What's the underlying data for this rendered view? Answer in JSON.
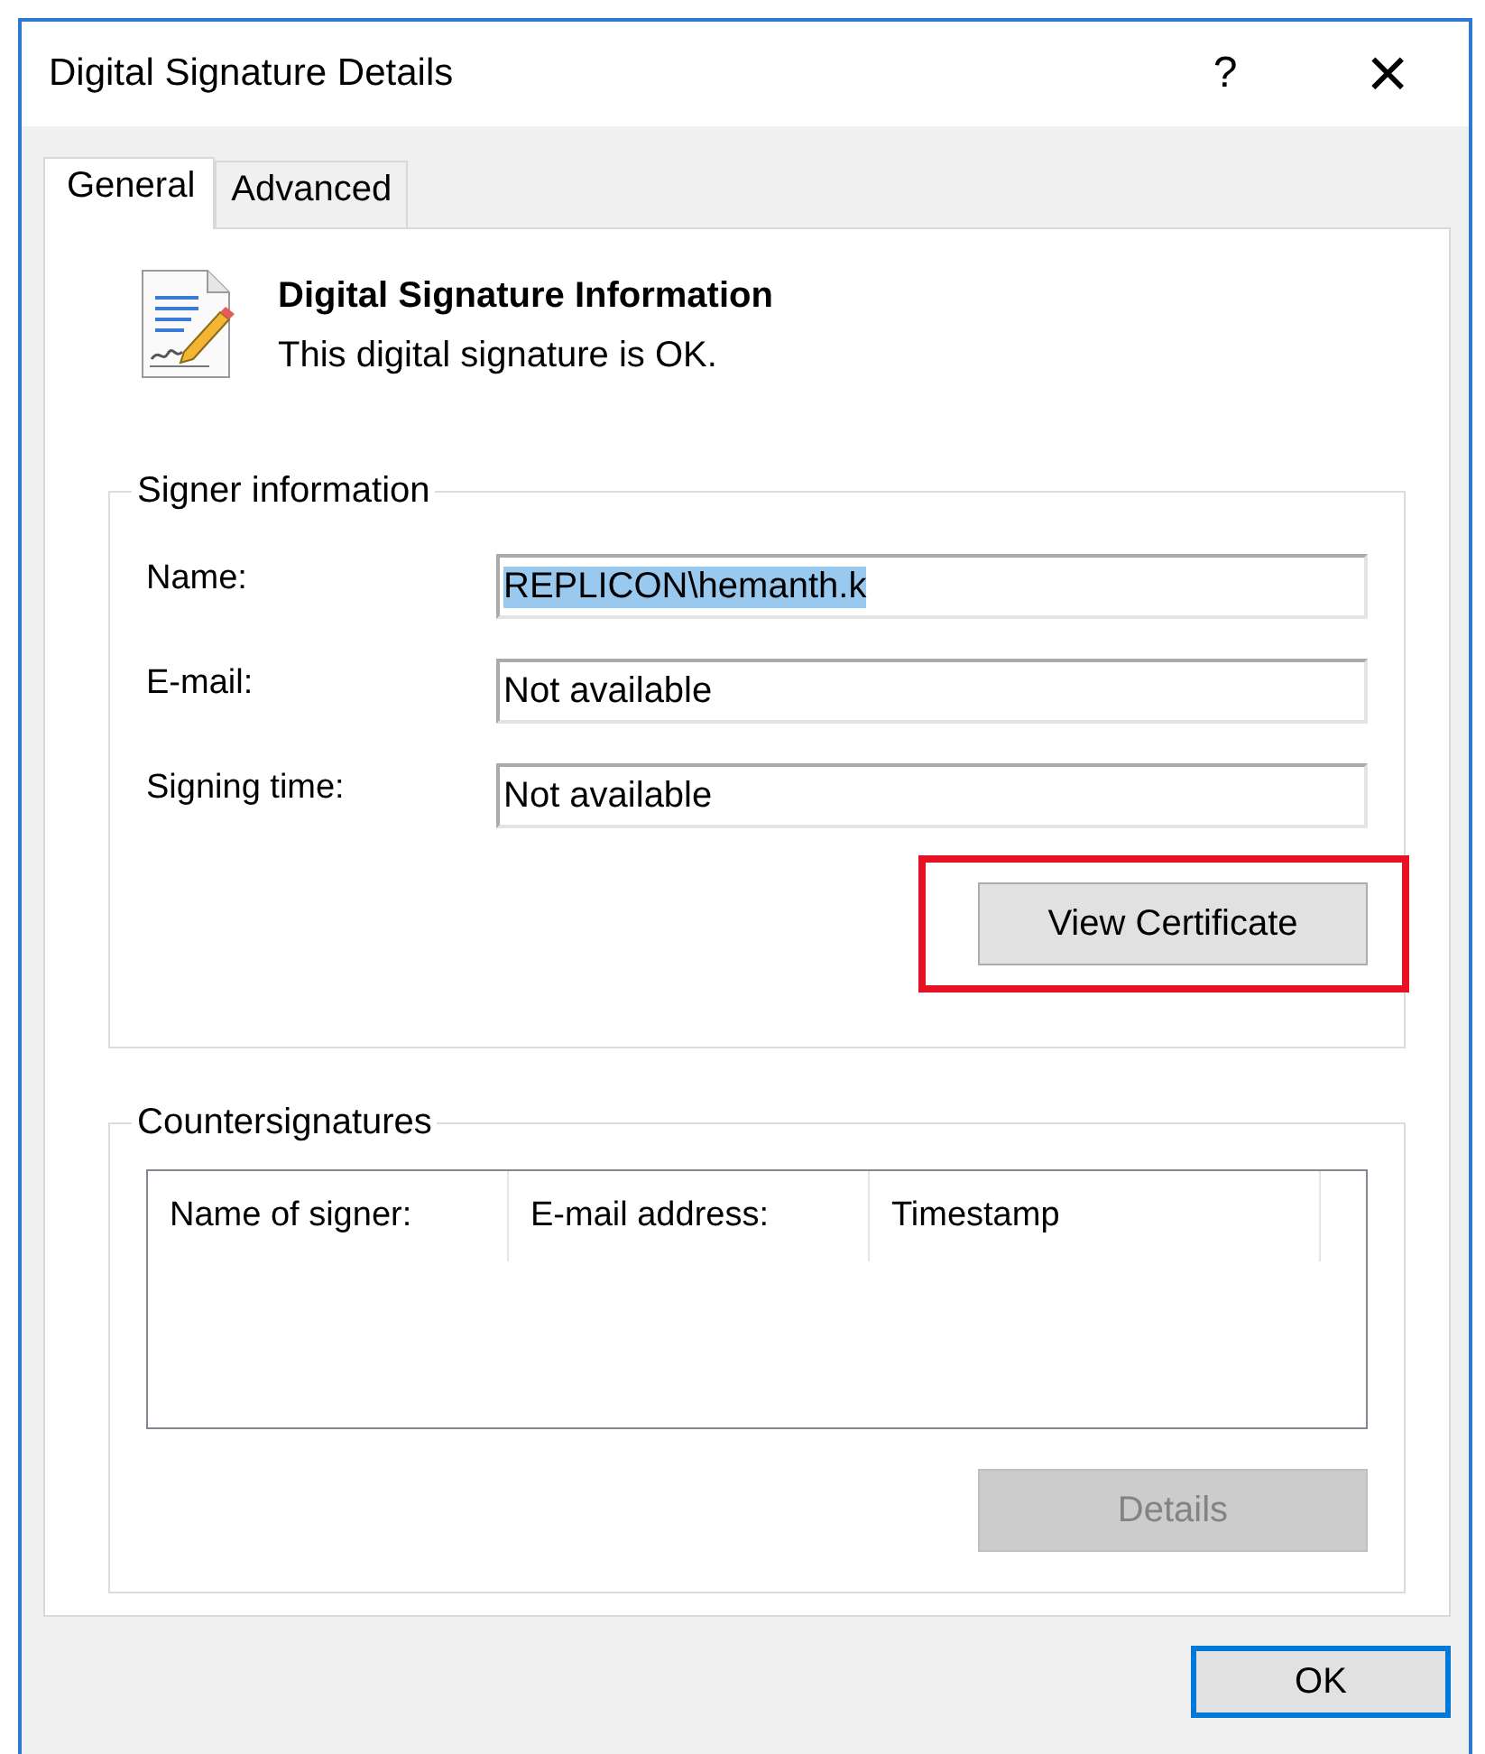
{
  "window": {
    "title": "Digital Signature Details",
    "help_glyph": "?",
    "close_glyph": "×"
  },
  "tabs": [
    {
      "label": "General",
      "selected": true
    },
    {
      "label": "Advanced",
      "selected": false
    }
  ],
  "header": {
    "title": "Digital Signature Information",
    "status": "This digital signature is OK."
  },
  "signer_information": {
    "title": "Signer information",
    "fields": [
      {
        "label": "Name:",
        "value": "REPLICON\\hemanth.k",
        "value_selected": true
      },
      {
        "label": "E-mail:",
        "value": "Not available",
        "value_selected": false
      },
      {
        "label": "Signing time:",
        "value": "Not available",
        "value_selected": false
      }
    ],
    "button": {
      "label": "View Certificate",
      "disabled": false,
      "highlighted": true
    }
  },
  "countersignatures": {
    "title": "Countersignatures",
    "columns": [
      "Name of signer:",
      "E-mail address:",
      "Timestamp"
    ],
    "button": {
      "label": "Details",
      "disabled": true
    }
  },
  "buttons": [
    {
      "label": "OK",
      "default": true
    }
  ]
}
